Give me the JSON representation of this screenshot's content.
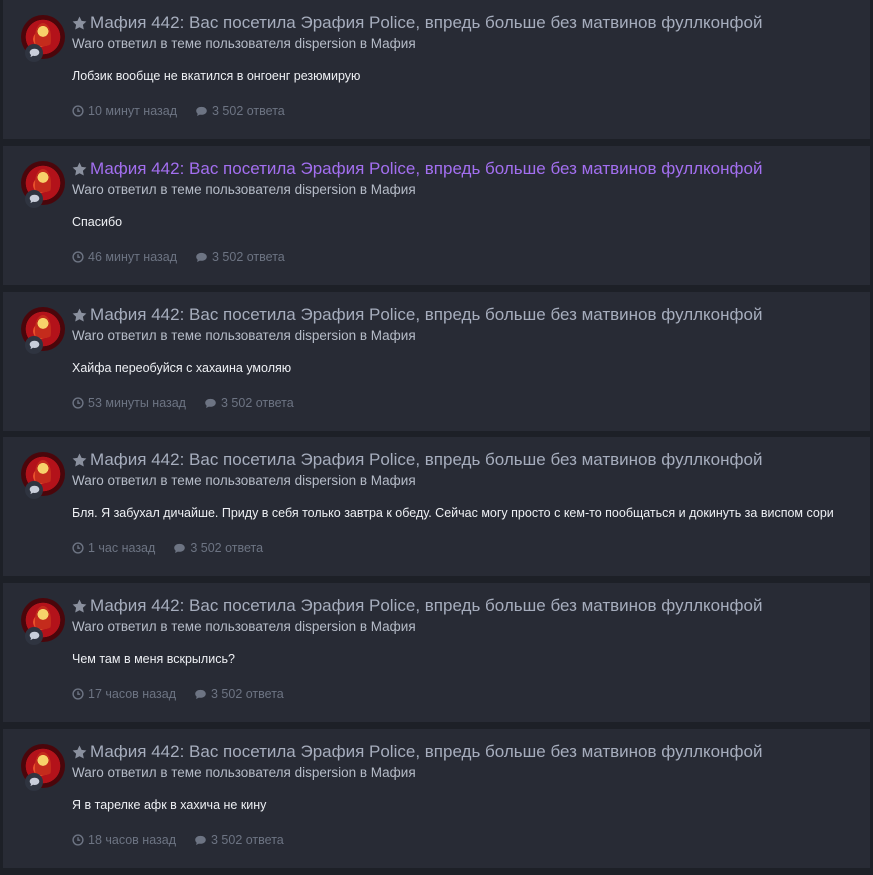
{
  "feed": {
    "items": [
      {
        "title": "Мафия 442: Вас посетила Эрафия Police, впредь больше без матвинов фуллконфой",
        "unread": false,
        "subtitle": "Waro ответил в теме пользователя dispersion в Мафия",
        "snippet": "Лобзик вообще не вкатился в онгоенг резюмирую",
        "time": "10 минут назад",
        "replies": "3 502 ответа"
      },
      {
        "title": "Мафия 442: Вас посетила Эрафия Police, впредь больше без матвинов фуллконфой",
        "unread": true,
        "subtitle": "Waro ответил в теме пользователя dispersion в Мафия",
        "snippet": "Спасибо",
        "time": "46 минут назад",
        "replies": "3 502 ответа"
      },
      {
        "title": "Мафия 442: Вас посетила Эрафия Police, впредь больше без матвинов фуллконфой",
        "unread": false,
        "subtitle": "Waro ответил в теме пользователя dispersion в Мафия",
        "snippet": "Хайфа переобуйся с хахаина умоляю",
        "time": "53 минуты назад",
        "replies": "3 502 ответа"
      },
      {
        "title": "Мафия 442: Вас посетила Эрафия Police, впредь больше без матвинов фуллконфой",
        "unread": false,
        "subtitle": "Waro ответил в теме пользователя dispersion в Мафия",
        "snippet": "Бля. Я забухал дичайше. Приду в себя только завтра к обеду. Сейчас могу просто с кем-то пообщаться и докинуть за виспом сори",
        "time": "1 час назад",
        "replies": "3 502 ответа"
      },
      {
        "title": "Мафия 442: Вас посетила Эрафия Police, впредь больше без матвинов фуллконфой",
        "unread": false,
        "subtitle": "Waro ответил в теме пользователя dispersion в Мафия",
        "snippet": "Чем там в меня вскрылись?",
        "time": "17 часов назад",
        "replies": "3 502 ответа"
      },
      {
        "title": "Мафия 442: Вас посетила Эрафия Police, впредь больше без матвинов фуллконфой",
        "unread": false,
        "subtitle": "Waro ответил в теме пользователя dispersion в Мафия",
        "snippet": "Я в тарелке афк в хахича не кину",
        "time": "18 часов назад",
        "replies": "3 502 ответа"
      }
    ]
  },
  "colors": {
    "background": "#1d2027",
    "card": "#282b35",
    "title": "#a6adbd",
    "title_unread": "#a36ff0",
    "meta": "#6d7483"
  },
  "icons": {
    "star": "star-icon",
    "type": "comment-icon",
    "time": "clock-icon",
    "replies": "comment-icon"
  }
}
